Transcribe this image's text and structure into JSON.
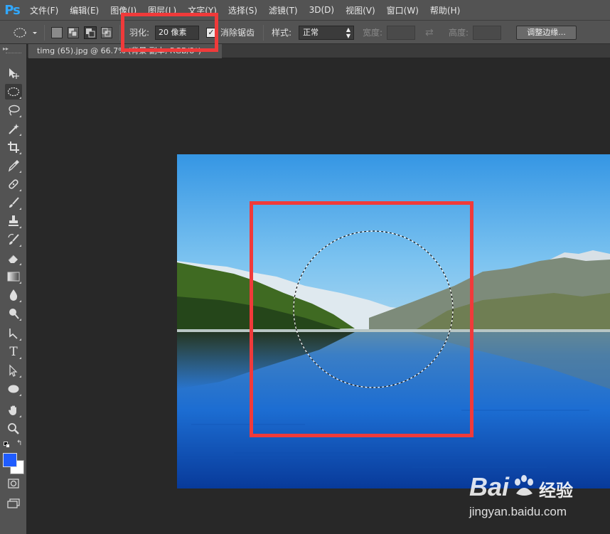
{
  "app": {
    "logo": "Ps"
  },
  "menu": [
    "文件(F)",
    "编辑(E)",
    "图像(I)",
    "图层(L)",
    "文字(Y)",
    "选择(S)",
    "滤镜(T)",
    "3D(D)",
    "视图(V)",
    "窗口(W)",
    "帮助(H)"
  ],
  "options": {
    "feather_label": "羽化:",
    "feather_value": "20 像素",
    "antialias_label": "消除锯齿",
    "antialias_checked": true,
    "style_label": "样式:",
    "style_value": "正常",
    "width_label": "宽度:",
    "height_label": "高度:",
    "refine_button": "调整边缘..."
  },
  "document": {
    "tab_title": "timg (65).jpg @ 66.7% (背景 副本, RGB/8*)"
  },
  "colors": {
    "foreground": "#1f5cff",
    "background": "#ffffff",
    "highlight": "#f03a3a"
  },
  "watermark": {
    "brand_cn": "经验",
    "url": "jingyan.baidu.com"
  }
}
